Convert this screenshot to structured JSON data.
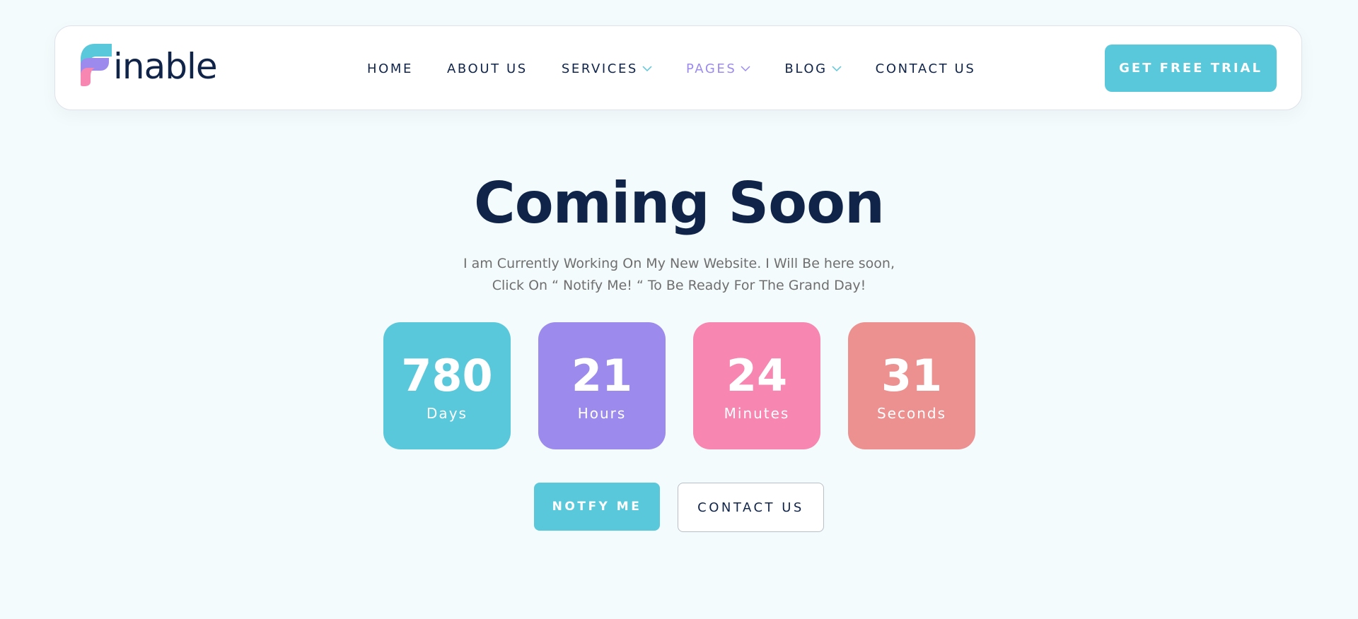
{
  "brand": {
    "logo_text": "inable",
    "colors": {
      "primary": "#59c8da",
      "purple": "#9c8aec",
      "pink": "#f786b1",
      "coral": "#ec9090",
      "navy": "#10244a"
    }
  },
  "nav": {
    "items": [
      {
        "label": "HOME",
        "has_dropdown": false,
        "active": false
      },
      {
        "label": "ABOUT US",
        "has_dropdown": false,
        "active": false
      },
      {
        "label": "SERVICES",
        "has_dropdown": true,
        "active": false
      },
      {
        "label": "PAGES",
        "has_dropdown": true,
        "active": true
      },
      {
        "label": "BLOG",
        "has_dropdown": true,
        "active": false
      },
      {
        "label": "CONTACT US",
        "has_dropdown": false,
        "active": false
      }
    ],
    "chevron_icon": "chevron-down-icon"
  },
  "header": {
    "trial_label": "GET FREE TRIAL"
  },
  "hero": {
    "title": "Coming Soon",
    "subtitle_line1": "I am Currently Working On My New Website. I Will Be here soon,",
    "subtitle_line2": "Click On “ Notify Me! “ To Be Ready For The Grand Day!"
  },
  "countdown": [
    {
      "value": "780",
      "label": "Days",
      "color": "#59c8da"
    },
    {
      "value": "21",
      "label": "Hours",
      "color": "#9c8aec"
    },
    {
      "value": "24",
      "label": "Minutes",
      "color": "#f786b1"
    },
    {
      "value": "31",
      "label": "Seconds",
      "color": "#ec9090"
    }
  ],
  "actions": {
    "notify_label": "NOTFY ME",
    "contact_label": "CONTACT US"
  }
}
